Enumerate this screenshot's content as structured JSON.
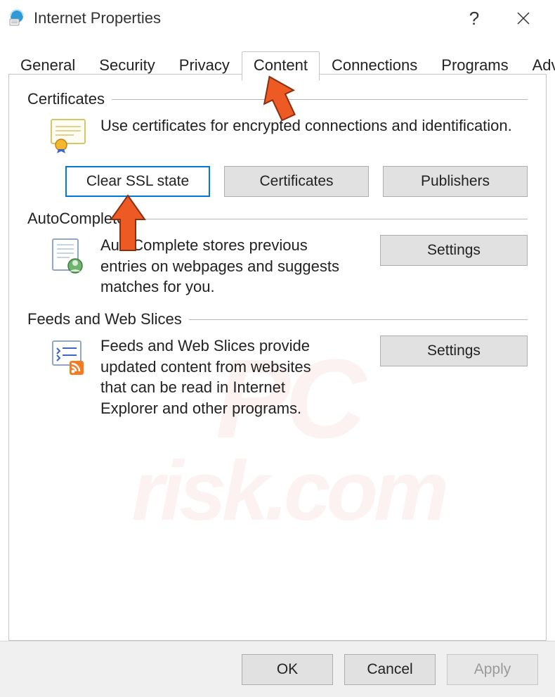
{
  "window": {
    "title": "Internet Properties"
  },
  "tabs": [
    {
      "label": "General"
    },
    {
      "label": "Security"
    },
    {
      "label": "Privacy"
    },
    {
      "label": "Content",
      "active": true
    },
    {
      "label": "Connections"
    },
    {
      "label": "Programs"
    },
    {
      "label": "Advanced"
    }
  ],
  "sections": {
    "certificates": {
      "title": "Certificates",
      "description": "Use certificates for encrypted connections and identification.",
      "buttons": {
        "clear_ssl": "Clear SSL state",
        "certificates": "Certificates",
        "publishers": "Publishers"
      }
    },
    "autocomplete": {
      "title": "AutoComplete",
      "description": "AutoComplete stores previous entries on webpages and suggests matches for you.",
      "settings": "Settings"
    },
    "feeds": {
      "title": "Feeds and Web Slices",
      "description": "Feeds and Web Slices provide updated content from websites that can be read in Internet Explorer and other programs.",
      "settings": "Settings"
    }
  },
  "actions": {
    "ok": "OK",
    "cancel": "Cancel",
    "apply": "Apply"
  },
  "watermark": {
    "line1": "PC",
    "line2": "risk.com"
  }
}
